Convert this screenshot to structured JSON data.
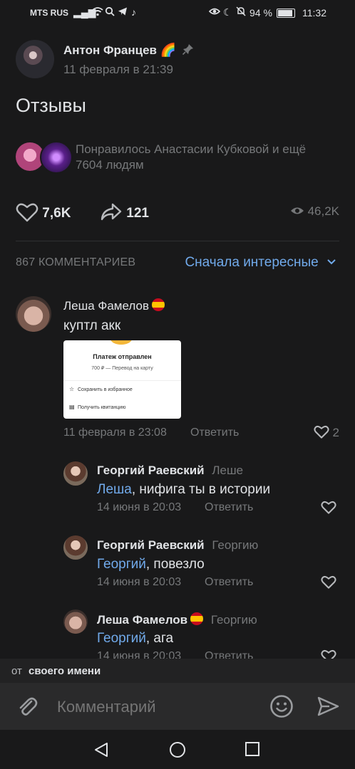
{
  "status_bar": {
    "carrier": "MTS RUS",
    "battery": "94 %",
    "time": "11:32"
  },
  "post": {
    "author": "Антон Францев",
    "date": "11 февраля в 21:39",
    "text": "Отзывы",
    "liked_by": "Понравилось Анастасии Кубковой и ещё 7604 людям",
    "likes": "7,6K",
    "shares": "121",
    "views": "46,2K"
  },
  "comments_header": {
    "count": "867 КОММЕНТАРИЕВ",
    "sort": "Сначала интересные"
  },
  "comments": [
    {
      "author": "Леша Фамелов",
      "text": "куптл акк",
      "date": "11 февраля в 23:08",
      "reply": "Ответить",
      "likes": "2",
      "attachment": {
        "title": "Платеж отправлен",
        "subtitle": "700 ₽ — Перевод на карту",
        "action1": "Сохранить в избранное",
        "action2": "Получить квитанцию"
      }
    }
  ],
  "replies": [
    {
      "author": "Георгий Раевский",
      "to": "Леше",
      "mention": "Леша",
      "text": ", нифига ты в истории",
      "date": "14 июня в 20:03",
      "reply": "Ответить"
    },
    {
      "author": "Георгий Раевский",
      "to": "Георгию",
      "mention": "Георгий",
      "text": ", повезло",
      "date": "14 июня в 20:03",
      "reply": "Ответить"
    },
    {
      "author": "Леша Фамелов",
      "to": "Георгию",
      "mention": "Георгий",
      "text": ", ага",
      "date": "14 июня в 20:03",
      "reply": "Ответить"
    }
  ],
  "composer": {
    "from_prefix": "от",
    "from_name": "своего имени",
    "placeholder": "Комментарий"
  }
}
